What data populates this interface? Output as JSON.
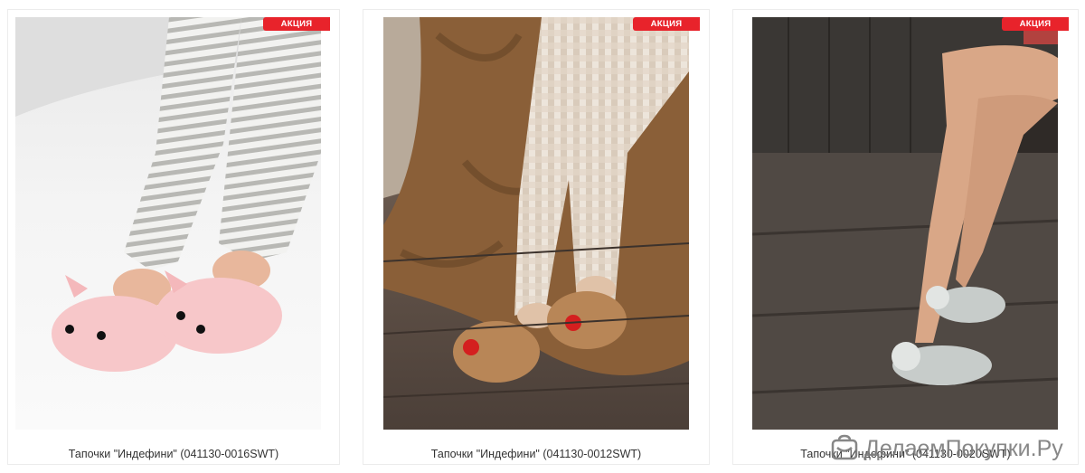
{
  "products": [
    {
      "badge": "АКЦИЯ",
      "title": "Тапочки \"Индефини\" (041130-0016SWT)"
    },
    {
      "badge": "АКЦИЯ",
      "title": "Тапочки \"Индефини\" (041130-0012SWT)"
    },
    {
      "badge": "АКЦИЯ",
      "title": "Тапочки \"Индефини\" (041130-0020SWT)"
    }
  ],
  "watermark": {
    "text": "ДелаемПокупки.Ру"
  },
  "colors": {
    "badge_bg": "#e8232b",
    "text": "#333333"
  },
  "icons": [
    "shopping-bag-logo-icon"
  ]
}
